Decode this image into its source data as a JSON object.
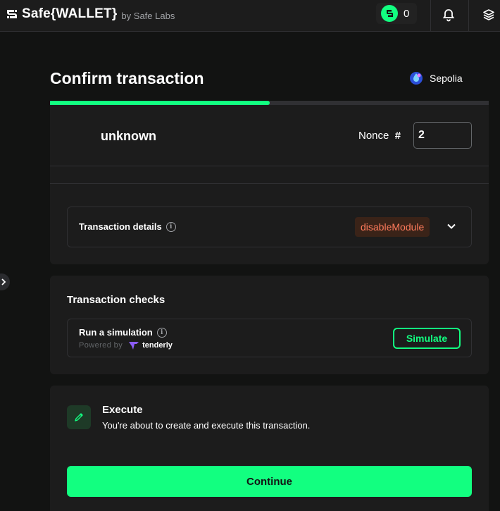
{
  "header": {
    "brand": "Safe{WALLET}",
    "by": "by",
    "company": "Safe Labs",
    "badge_count": "0",
    "icons": [
      "safe-token-icon",
      "bell-icon",
      "layers-icon"
    ]
  },
  "page": {
    "title": "Confirm transaction",
    "network": "Sepolia",
    "progress_fraction": 0.5
  },
  "summary": {
    "name": "unknown",
    "nonce_label": "Nonce",
    "nonce_hash": "#",
    "nonce_value": "2"
  },
  "details": {
    "label": "Transaction details",
    "method": "disableModule",
    "method_color": "#ff7b5c"
  },
  "checks": {
    "title": "Transaction checks",
    "simulation_label": "Run a simulation",
    "powered_by": "Powered by",
    "provider": "tenderly",
    "simulate_button": "Simulate"
  },
  "execute": {
    "title": "Execute",
    "description": "You're about to create and execute this transaction.",
    "continue_button": "Continue"
  },
  "colors": {
    "accent": "#12ff80",
    "background": "#121312",
    "card": "#1c1c1c"
  }
}
